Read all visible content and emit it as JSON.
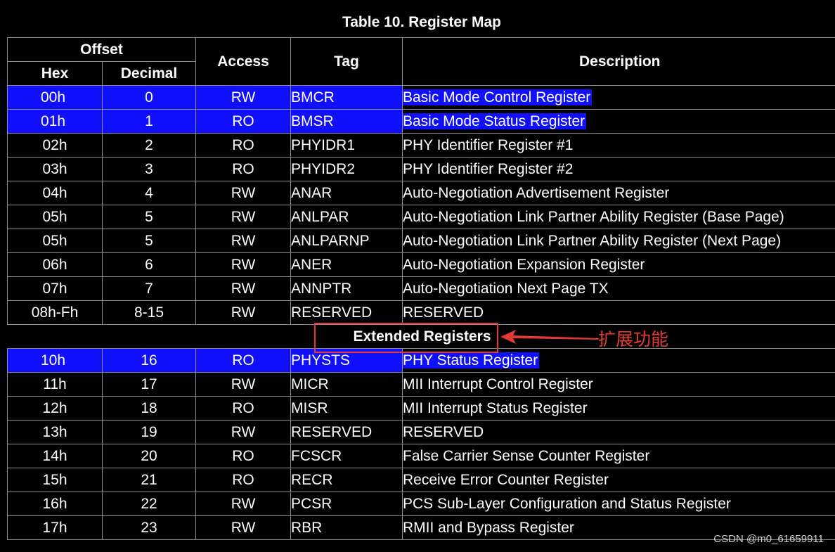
{
  "title": "Table 10.  Register Map",
  "headers": {
    "offset": "Offset",
    "hex": "Hex",
    "decimal": "Decimal",
    "access": "Access",
    "tag": "Tag",
    "description": "Description"
  },
  "rows": [
    {
      "hex": "00h",
      "dec": "0",
      "access": "RW",
      "tag": "BMCR",
      "desc": "Basic Mode Control Register",
      "highlight": true
    },
    {
      "hex": "01h",
      "dec": "1",
      "access": "RO",
      "tag": "BMSR",
      "desc": "Basic Mode Status Register",
      "highlight": true
    },
    {
      "hex": "02h",
      "dec": "2",
      "access": "RO",
      "tag": "PHYIDR1",
      "desc": "PHY Identifier Register #1",
      "highlight": false
    },
    {
      "hex": "03h",
      "dec": "3",
      "access": "RO",
      "tag": "PHYIDR2",
      "desc": "PHY Identifier Register #2",
      "highlight": false
    },
    {
      "hex": "04h",
      "dec": "4",
      "access": "RW",
      "tag": "ANAR",
      "desc": "Auto-Negotiation Advertisement Register",
      "highlight": false
    },
    {
      "hex": "05h",
      "dec": "5",
      "access": "RW",
      "tag": "ANLPAR",
      "desc": "Auto-Negotiation Link Partner Ability Register (Base Page)",
      "highlight": false
    },
    {
      "hex": "05h",
      "dec": "5",
      "access": "RW",
      "tag": "ANLPARNP",
      "desc": "Auto-Negotiation Link Partner Ability Register (Next Page)",
      "highlight": false
    },
    {
      "hex": "06h",
      "dec": "6",
      "access": "RW",
      "tag": "ANER",
      "desc": "Auto-Negotiation Expansion Register",
      "highlight": false
    },
    {
      "hex": "07h",
      "dec": "7",
      "access": "RW",
      "tag": "ANNPTR",
      "desc": "Auto-Negotiation Next Page TX",
      "highlight": false
    },
    {
      "hex": "08h-Fh",
      "dec": "8-15",
      "access": "RW",
      "tag": "RESERVED",
      "desc": "RESERVED",
      "highlight": false
    }
  ],
  "section_label": "Extended Registers",
  "ext_rows": [
    {
      "hex": "10h",
      "dec": "16",
      "access": "RO",
      "tag": "PHYSTS",
      "desc": "PHY Status Register",
      "highlight": true
    },
    {
      "hex": "11h",
      "dec": "17",
      "access": "RW",
      "tag": "MICR",
      "desc": "MII Interrupt Control Register",
      "highlight": false
    },
    {
      "hex": "12h",
      "dec": "18",
      "access": "RO",
      "tag": "MISR",
      "desc": "MII Interrupt Status Register",
      "highlight": false
    },
    {
      "hex": "13h",
      "dec": "19",
      "access": "RW",
      "tag": "RESERVED",
      "desc": "RESERVED",
      "highlight": false
    },
    {
      "hex": "14h",
      "dec": "20",
      "access": "RO",
      "tag": "FCSCR",
      "desc": "False Carrier Sense Counter Register",
      "highlight": false
    },
    {
      "hex": "15h",
      "dec": "21",
      "access": "RO",
      "tag": "RECR",
      "desc": "Receive Error Counter Register",
      "highlight": false
    },
    {
      "hex": "16h",
      "dec": "22",
      "access": "RW",
      "tag": "PCSR",
      "desc": "PCS Sub-Layer Configuration and Status Register",
      "highlight": false
    },
    {
      "hex": "17h",
      "dec": "23",
      "access": "RW",
      "tag": "RBR",
      "desc": "RMII and Bypass Register",
      "highlight": false
    }
  ],
  "annotation": {
    "text": "扩展功能",
    "color": "#e53935"
  },
  "watermark": "CSDN @m0_61659911",
  "colors": {
    "highlight": "#1010ff",
    "background": "#000000",
    "text": "#ffffff"
  }
}
